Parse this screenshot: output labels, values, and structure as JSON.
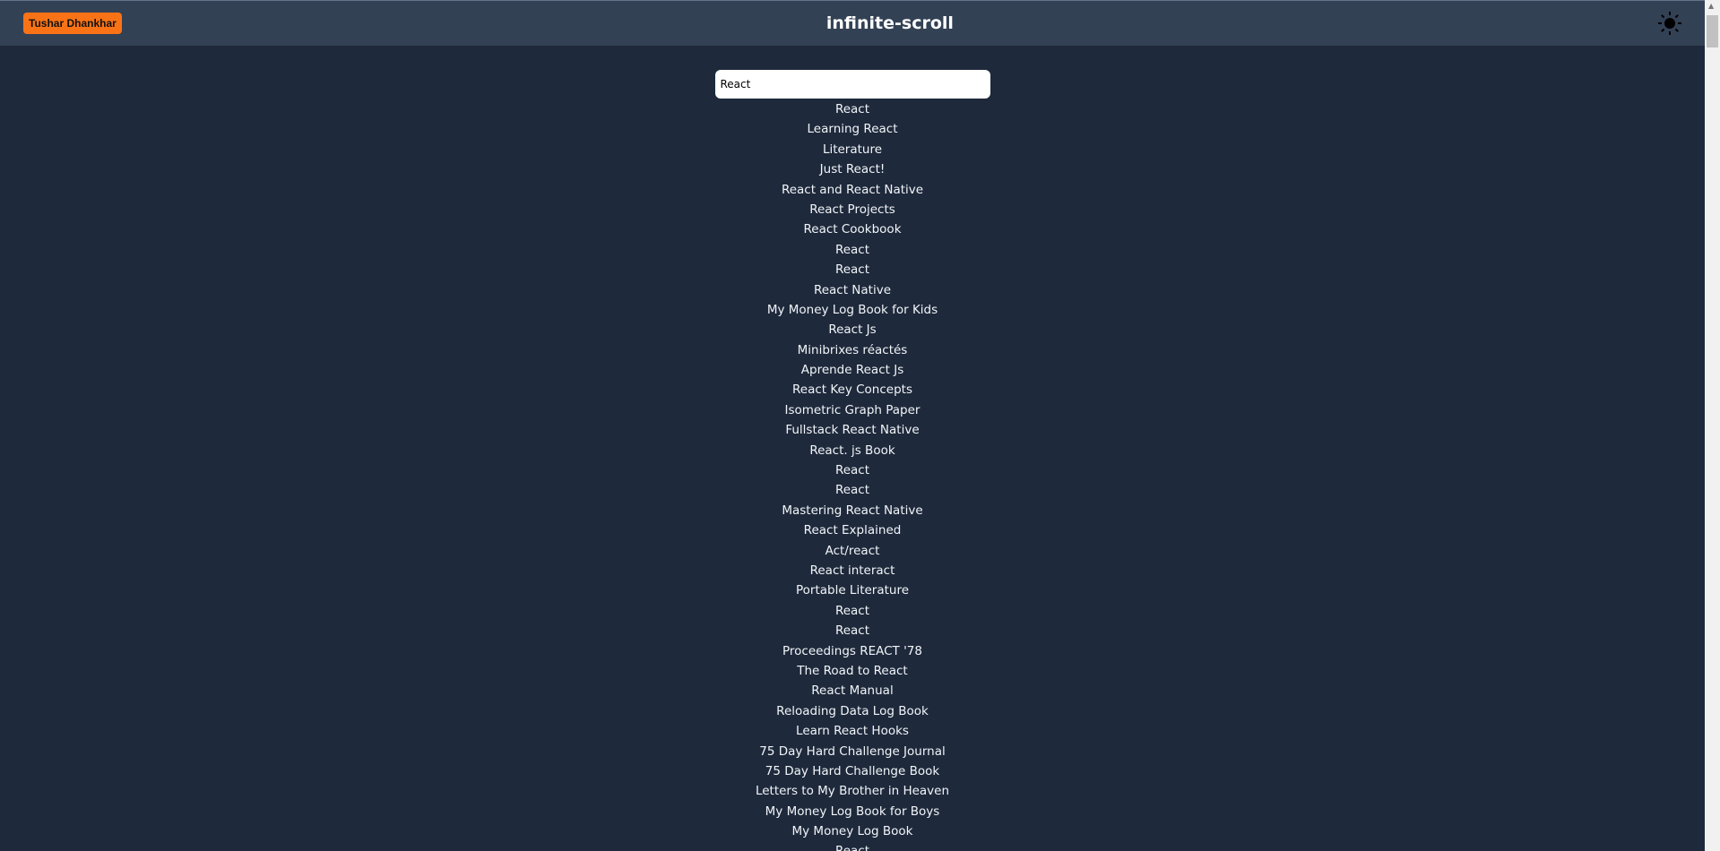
{
  "header": {
    "user_button": "Tushar Dhankhar",
    "title": "infinite-scroll",
    "theme_icon": "sun-icon"
  },
  "search": {
    "value": "React"
  },
  "results": [
    "React",
    "Learning React",
    "Literature",
    "Just React!",
    "React and React Native",
    "React Projects",
    "React Cookbook",
    "React",
    "React",
    "React Native",
    "My Money Log Book for Kids",
    "React Js",
    "Minibrixes réactés",
    "Aprende React Js",
    "React Key Concepts",
    "Isometric Graph Paper",
    "Fullstack React Native",
    "React. js Book",
    "React",
    "React",
    "Mastering React Native",
    "React Explained",
    "Act/react",
    "React interact",
    "Portable Literature",
    "React",
    "React",
    "Proceedings REACT '78",
    "The Road to React",
    "React Manual",
    "Reloading Data Log Book",
    "Learn React Hooks",
    "75 Day Hard Challenge Journal",
    "75 Day Hard Challenge Book",
    "Letters to My Brother in Heaven",
    "My Money Log Book for Boys",
    "My Money Log Book",
    "React"
  ],
  "colors": {
    "header_bg": "#334155",
    "page_bg": "#1e293b",
    "accent": "#f97316"
  }
}
